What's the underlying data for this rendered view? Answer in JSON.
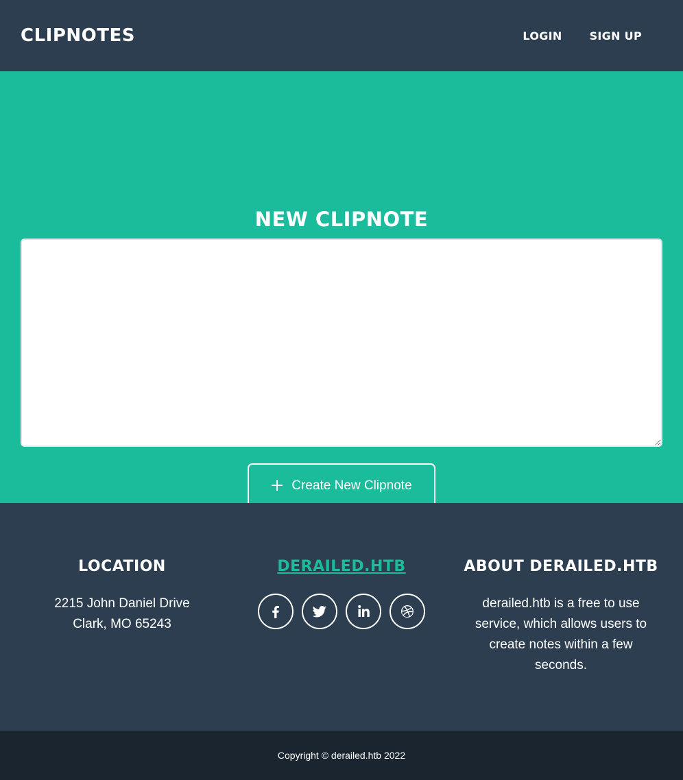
{
  "navbar": {
    "brand": "CLIPNOTES",
    "links": [
      "LOGIN",
      "SIGN UP"
    ]
  },
  "main": {
    "title": "NEW CLIPNOTE",
    "textarea_value": "",
    "button_label": "Create New Clipnote",
    "button_icon": "plus-icon"
  },
  "footer": {
    "location": {
      "heading": "LOCATION",
      "address_line1": "2215 John Daniel Drive",
      "address_line2": "Clark, MO 65243"
    },
    "site": {
      "heading": "DERAILED.HTB",
      "socials": [
        "facebook-icon",
        "twitter-icon",
        "linkedin-icon",
        "dribbble-icon"
      ]
    },
    "about": {
      "heading": "ABOUT DERAILED.HTB",
      "text": "derailed.htb is a free to use service, which allows users to create notes within a few seconds."
    }
  },
  "copyright": "Copyright © derailed.htb 2022",
  "colors": {
    "navy": "#2c3e50",
    "teal": "#1abc9c",
    "dark": "#1a252f"
  }
}
